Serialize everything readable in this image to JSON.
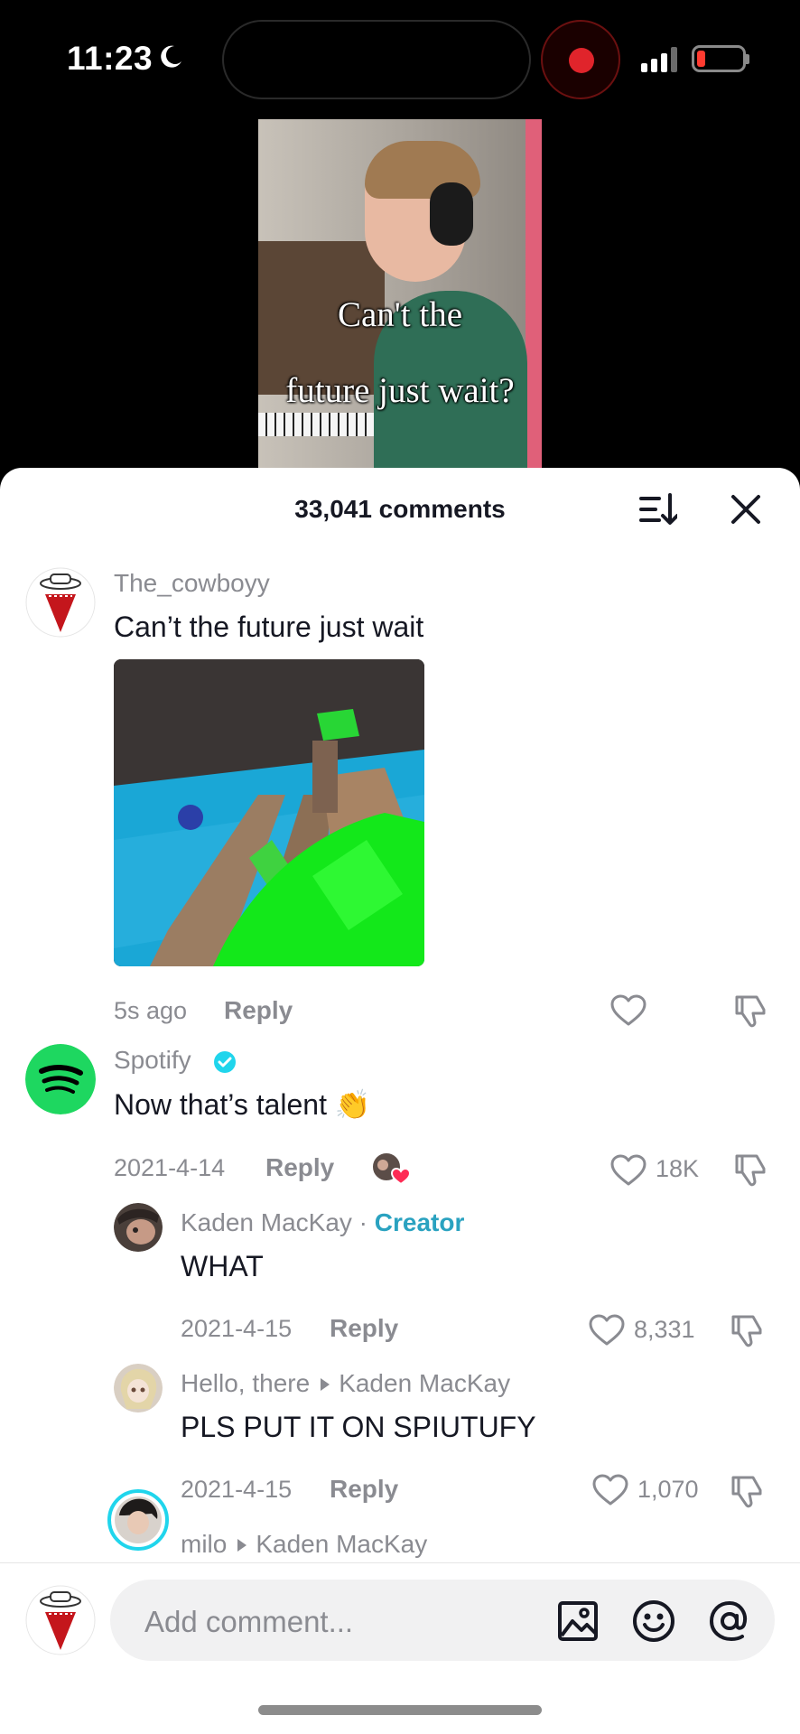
{
  "status_bar": {
    "time": "11:23",
    "colors": {
      "record": "#e0242b",
      "battery_low": "#ff3b30"
    }
  },
  "video": {
    "caption_line1": "Can't the",
    "caption_line2": "future just wait?"
  },
  "comments_sheet": {
    "title": "33,041 comments",
    "sort_icon": "sort-icon",
    "close_icon": "close-icon"
  },
  "comments": [
    {
      "username": "The_cowboyy",
      "text": "Can’t the future just wait",
      "time": "5s ago",
      "reply_label": "Reply",
      "like_count": ""
    },
    {
      "username": "Spotify",
      "verified": true,
      "text": "Now that’s talent 👏",
      "time": "2021-4-14",
      "reply_label": "Reply",
      "like_count": "18K",
      "brand_color": "#1ed760"
    }
  ],
  "replies": [
    {
      "username": "Kaden MacKay",
      "tag": "Creator",
      "tag_separator": "·",
      "text": "WHAT",
      "time": "2021-4-15",
      "reply_label": "Reply",
      "like_count": "8,331"
    },
    {
      "username": "Hello, there",
      "reply_to": "Kaden MacKay",
      "text": "PLS PUT IT ON SPIUTUFY",
      "time": "2021-4-15",
      "reply_label": "Reply",
      "like_count": "1,070"
    },
    {
      "username": "milo",
      "reply_to": "Kaden MacKay"
    }
  ],
  "comment_input": {
    "placeholder": "Add comment...",
    "icons": [
      "image-icon",
      "emoji-icon",
      "mention-icon"
    ]
  }
}
